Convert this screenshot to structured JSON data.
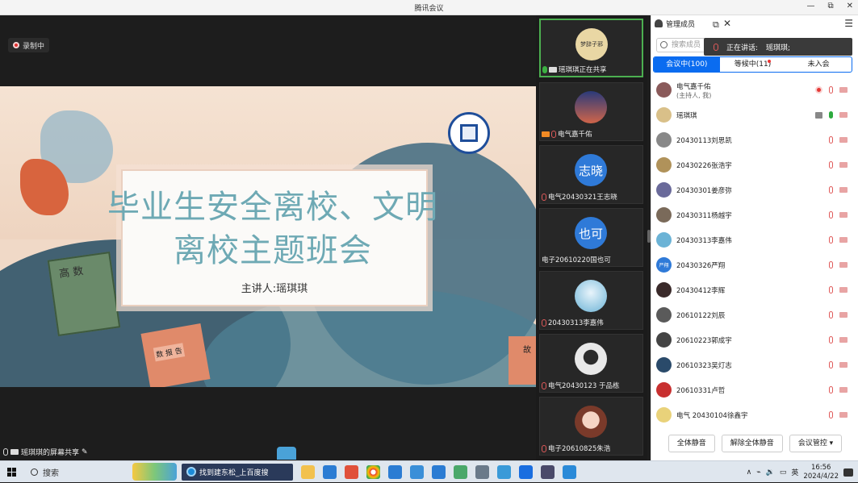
{
  "window": {
    "title": "腾讯会议",
    "minimize": "—",
    "restore": "⧉",
    "close": "✕"
  },
  "stage": {
    "recording_label": "录制中",
    "slide": {
      "title": "毕业生安全离校、文明离校主题班会",
      "speaker": "主讲人:瑶琪琪",
      "book_main": "高 数",
      "book_small": "数 报 告",
      "book_right": "故"
    },
    "share_status": "瑶琪琪的屏幕共享"
  },
  "tiles": [
    {
      "name": "瑶琪琪正在共享",
      "avatar_text": "梦辞子邪",
      "avatar_color": "#e9d7a4",
      "active": true,
      "cam": true
    },
    {
      "name": "电气嘉千佑",
      "avatar_text": "",
      "avatar_color": "#7a4a6a",
      "cam_orange": true
    },
    {
      "name": "电气20430321王志晓",
      "avatar_text": "志晓",
      "avatar_color": "#2f7ad8"
    },
    {
      "name": "电子20610220国也可",
      "avatar_text": "也可",
      "avatar_color": "#2f7ad8"
    },
    {
      "name": "20430313李嘉伟",
      "avatar_text": "",
      "avatar_color": "#6bb3d6"
    },
    {
      "name": "电气20430123 于品栋",
      "avatar_text": "",
      "avatar_color": "#e8e8e8"
    },
    {
      "name": "电子20610825朱浩",
      "avatar_text": "",
      "avatar_color": "#e2bfae"
    }
  ],
  "panel": {
    "title": "管理成员",
    "search_placeholder": "搜索成员",
    "speaking_label": "正在讲话:",
    "speaking_name": "瑶琪琪;",
    "tabs": [
      {
        "label": "会议中(100)",
        "active": true
      },
      {
        "label": "等候中(11)",
        "active": false,
        "dot": true
      },
      {
        "label": "未入会",
        "active": false
      }
    ],
    "members": [
      {
        "name": "电气嘉千佑",
        "sub": "(主持人, 我)",
        "color": "#8a5a5a",
        "recording": true,
        "mic": "red"
      },
      {
        "name": "瑶琪琪",
        "sub": "",
        "color": "#d9c089",
        "share": true,
        "mic": "green"
      },
      {
        "name": "20430113刘思凯",
        "color": "#888888",
        "mic": "red"
      },
      {
        "name": "20430226张浩宇",
        "color": "#b0925a",
        "mic": "red"
      },
      {
        "name": "20430301姜彦弥",
        "color": "#6a6a9a",
        "mic": "red"
      },
      {
        "name": "20430311杨越宇",
        "color": "#7a6a5a",
        "mic": "red"
      },
      {
        "name": "20430313李嘉伟",
        "color": "#6bb3d6",
        "mic": "red"
      },
      {
        "name": "20430326严翔",
        "avatar_text": "严翔",
        "color": "#2f7ad8",
        "mic": "red"
      },
      {
        "name": "20430412李辉",
        "color": "#3a2a2a",
        "mic": "red"
      },
      {
        "name": "20610122刘辰",
        "color": "#5a5a5a",
        "mic": "red"
      },
      {
        "name": "20610223郭成宇",
        "color": "#444444",
        "mic": "red"
      },
      {
        "name": "20610323吴灯志",
        "color": "#2a4a6a",
        "mic": "red"
      },
      {
        "name": "20610331卢哲",
        "color": "#c83030",
        "mic": "red"
      },
      {
        "name": "电气 20430104徐鑫宇",
        "color": "#e9d27a",
        "mic": "red"
      }
    ],
    "footer": {
      "mute_all": "全体静音",
      "unmute_all": "解除全体静音",
      "manage": "会议管控 ▾"
    }
  },
  "taskbar": {
    "search": "搜索",
    "browser_tab": "找到建东松_上百度搜",
    "ime": "英",
    "time": "16:56",
    "date": "2024/4/22"
  }
}
